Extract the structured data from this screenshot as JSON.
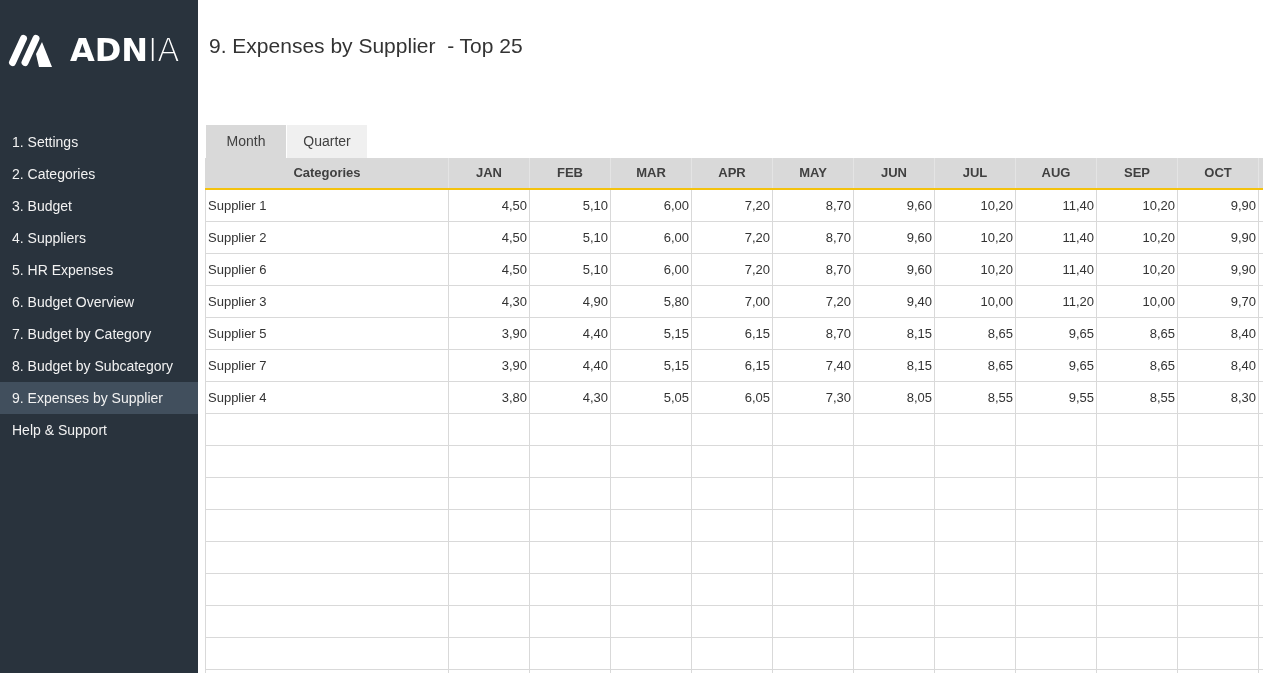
{
  "sidebar": {
    "logo": {
      "text": "**ADN**IA"
    },
    "items": [
      {
        "label": "1. Settings",
        "selected": false
      },
      {
        "label": "2. Categories",
        "selected": false
      },
      {
        "label": "3. Budget",
        "selected": false
      },
      {
        "label": "4. Suppliers",
        "selected": false
      },
      {
        "label": "5. HR Expenses",
        "selected": false
      },
      {
        "label": "6. Budget Overview",
        "selected": false
      },
      {
        "label": "7. Budget by Category",
        "selected": false
      },
      {
        "label": "8. Budget by Subcategory",
        "selected": false
      },
      {
        "label": "9. Expenses by Supplier",
        "selected": true
      },
      {
        "label": "Help & Support",
        "selected": false
      }
    ]
  },
  "page": {
    "title": "9. Expenses by Supplier  - Top 25"
  },
  "tabs": [
    {
      "label": "Month",
      "selected": true
    },
    {
      "label": "Quarter",
      "selected": false
    }
  ],
  "table": {
    "columns": [
      "Categories",
      "JAN",
      "FEB",
      "MAR",
      "APR",
      "MAY",
      "JUN",
      "JUL",
      "AUG",
      "SEP",
      "OCT"
    ],
    "rows": [
      {
        "name": "Supplier 1",
        "values": [
          "4,50",
          "5,10",
          "6,00",
          "7,20",
          "8,70",
          "9,60",
          "10,20",
          "11,40",
          "10,20",
          "9,90"
        ]
      },
      {
        "name": "Supplier 2",
        "values": [
          "4,50",
          "5,10",
          "6,00",
          "7,20",
          "8,70",
          "9,60",
          "10,20",
          "11,40",
          "10,20",
          "9,90"
        ]
      },
      {
        "name": "Supplier 6",
        "values": [
          "4,50",
          "5,10",
          "6,00",
          "7,20",
          "8,70",
          "9,60",
          "10,20",
          "11,40",
          "10,20",
          "9,90"
        ]
      },
      {
        "name": "Supplier 3",
        "values": [
          "4,30",
          "4,90",
          "5,80",
          "7,00",
          "7,20",
          "9,40",
          "10,00",
          "11,20",
          "10,00",
          "9,70"
        ]
      },
      {
        "name": "Supplier 5",
        "values": [
          "3,90",
          "4,40",
          "5,15",
          "6,15",
          "8,70",
          "8,15",
          "8,65",
          "9,65",
          "8,65",
          "8,40"
        ]
      },
      {
        "name": "Supplier 7",
        "values": [
          "3,90",
          "4,40",
          "5,15",
          "6,15",
          "7,40",
          "8,15",
          "8,65",
          "9,65",
          "8,65",
          "8,40"
        ]
      },
      {
        "name": "Supplier 4",
        "values": [
          "3,80",
          "4,30",
          "5,05",
          "6,05",
          "7,30",
          "8,05",
          "8,55",
          "9,55",
          "8,55",
          "8,30"
        ]
      }
    ]
  }
}
